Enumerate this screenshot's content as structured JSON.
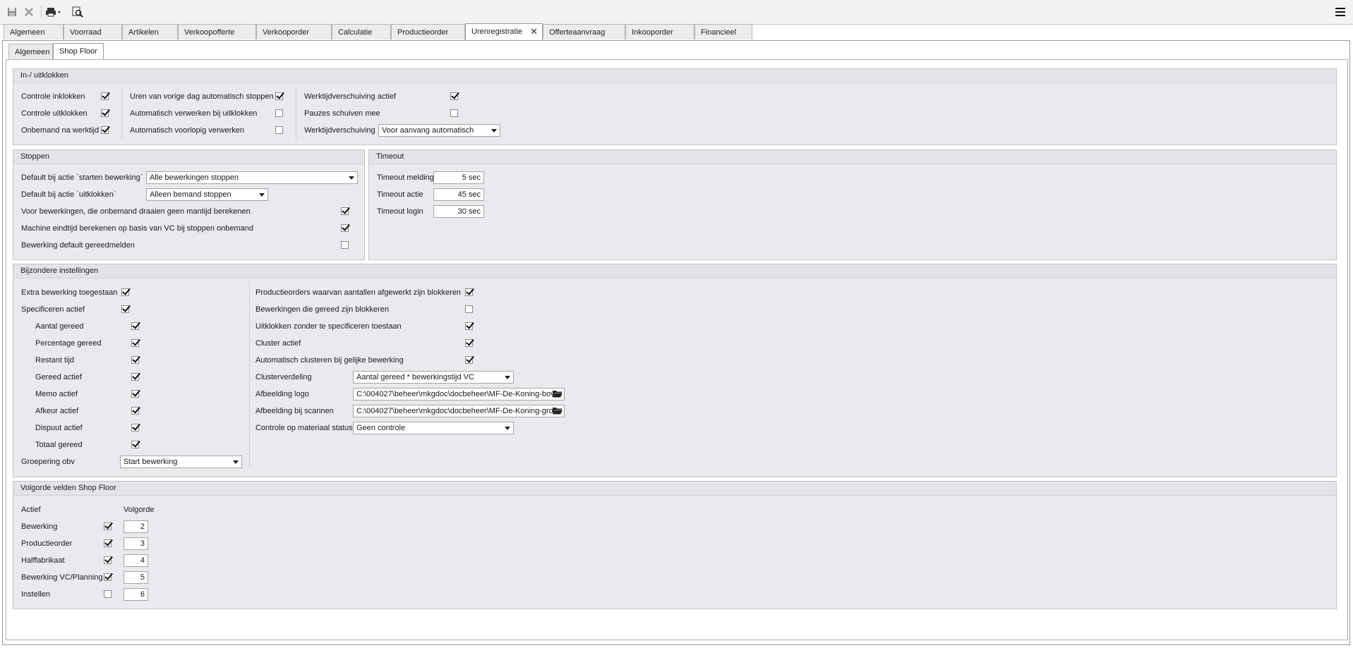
{
  "toolbar": {
    "save_icon": "save-icon",
    "cancel_icon": "cancel-icon",
    "print_icon": "print-icon",
    "preview_icon": "print-preview-icon",
    "menu_icon": "hamburger-menu-icon"
  },
  "tabs": [
    {
      "label": "Algemeen"
    },
    {
      "label": "Voorraad"
    },
    {
      "label": "Artikelen"
    },
    {
      "label": "Verkoopofferte"
    },
    {
      "label": "Verkooporder"
    },
    {
      "label": "Calculatie"
    },
    {
      "label": "Productieorder"
    },
    {
      "label": "Urenregistratie"
    },
    {
      "label": "Offerteaanvraag"
    },
    {
      "label": "Inkooporder"
    },
    {
      "label": "Financieel"
    }
  ],
  "active_tab": "Urenregistratie",
  "subtabs": [
    {
      "label": "Algemeen"
    },
    {
      "label": "Shop Floor"
    }
  ],
  "active_subtab": "Shop Floor",
  "inuit": {
    "title": "In-/ uitklokken",
    "col1": [
      {
        "label": "Controle inklokken",
        "checked": true
      },
      {
        "label": "Controle uitklokken",
        "checked": true
      },
      {
        "label": "Onbemand na werktijd",
        "checked": true
      }
    ],
    "col2": [
      {
        "label": "Uren van vorige dag automatisch stoppen",
        "checked": true
      },
      {
        "label": "Automatisch verwerken bij uitklokken",
        "checked": false
      },
      {
        "label": "Automatisch voorlopig verwerken",
        "checked": false
      }
    ],
    "col3": [
      {
        "label": "Werktijdverschuiving actief",
        "checked": true
      },
      {
        "label": "Pauzes schuiven mee",
        "checked": false
      }
    ],
    "werktijd_label": "Werktijdverschuiving",
    "werktijd_value": "Voor aanvang automatisch"
  },
  "stoppen": {
    "title": "Stoppen",
    "start_label": "Default bij actie `starten bewerking`",
    "start_value": "Alle bewerkingen stoppen",
    "uit_label": "Default bij actie `uitklokken`",
    "uit_value": "Alleen bemand stoppen",
    "checks": [
      {
        "label": "Voor bewerkingen, die onbemand draaien geen mantijd berekenen",
        "checked": true
      },
      {
        "label": "Machine eindtijd berekenen op basis van VC bij stoppen onbemand",
        "checked": true
      },
      {
        "label": "Bewerking default gereedmelden",
        "checked": false
      }
    ]
  },
  "timeout": {
    "title": "Timeout",
    "rows": [
      {
        "label": "Timeout melding",
        "value": "5 sec"
      },
      {
        "label": "Timeout actie",
        "value": "45 sec"
      },
      {
        "label": "Timeout login",
        "value": "30 sec"
      }
    ]
  },
  "bijzonder": {
    "title": "Bijzondere instellingen",
    "extra": {
      "label": "Extra bewerking toegestaan",
      "checked": true
    },
    "spec": {
      "label": "Specificeren actief",
      "checked": true
    },
    "sub": [
      {
        "label": "Aantal gereed",
        "checked": true
      },
      {
        "label": "Percentage gereed",
        "checked": true
      },
      {
        "label": "Restant tijd",
        "checked": true
      },
      {
        "label": "Gereed actief",
        "checked": true
      },
      {
        "label": "Memo actief",
        "checked": true
      },
      {
        "label": "Afkeur actief",
        "checked": true
      },
      {
        "label": "Dispuut actief",
        "checked": true
      },
      {
        "label": "Totaal gereed",
        "checked": true
      }
    ],
    "groep_label": "Groepering obv",
    "groep_value": "Start bewerking",
    "right_checks": [
      {
        "label": "Productieorders waarvan aantallen afgewerkt zijn blokkeren",
        "checked": true
      },
      {
        "label": "Bewerkingen die gereed zijn blokkeren",
        "checked": false
      },
      {
        "label": "Uitklokken zonder te specificeren toestaan",
        "checked": true
      },
      {
        "label": "Cluster actief",
        "checked": true
      },
      {
        "label": "Automatisch clusteren bij gelijke bewerking",
        "checked": true
      }
    ],
    "cluster_label": "Clusterverdeling",
    "cluster_value": "Aantal gereed * bewerkingstijd VC",
    "logo_label": "Afbeelding logo",
    "logo_value": "C:\\004027\\beheer\\mkgdoc\\docbeheer\\MF-De-Koning-bov",
    "scan_label": "Afbeelding bij scannen",
    "scan_value": "C:\\004027\\beheer\\mkgdoc\\docbeheer\\MF-De-Koning-gro",
    "materiaal_label": "Controle op materiaal status",
    "materiaal_value": "Geen controle"
  },
  "volgorde": {
    "title": "Volgorde velden Shop Floor",
    "col_actief": "Actief",
    "col_volgorde": "Volgorde",
    "rows": [
      {
        "label": "Bewerking",
        "checked": true,
        "order": "2"
      },
      {
        "label": "Productieorder",
        "checked": true,
        "order": "3"
      },
      {
        "label": "Halffabrikaat",
        "checked": true,
        "order": "4"
      },
      {
        "label": "Bewerking VC/Planning",
        "checked": true,
        "order": "5"
      },
      {
        "label": "Instellen",
        "checked": false,
        "order": "6"
      }
    ]
  }
}
